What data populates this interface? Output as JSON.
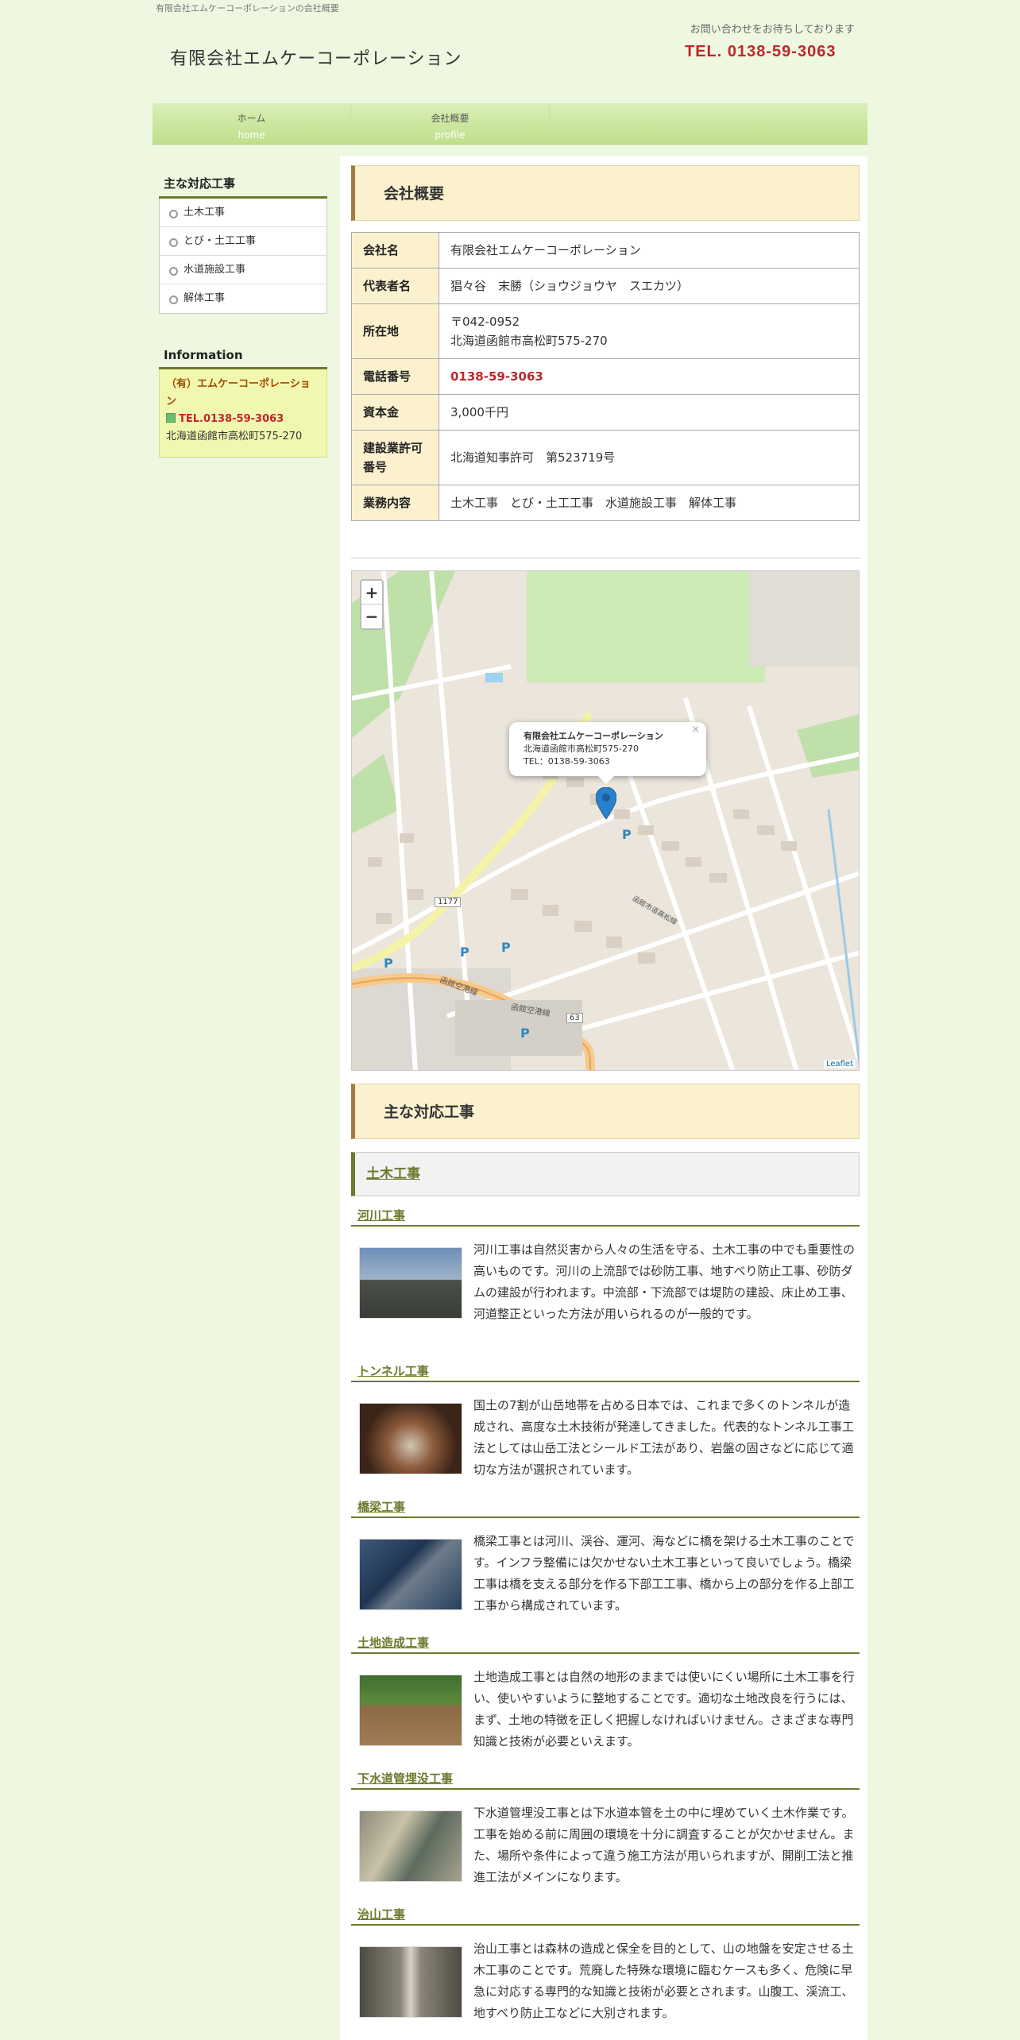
{
  "header": {
    "tagline": "有限会社エムケーコーポレーションの会社概要",
    "site_title": "有限会社エムケーコーポレーション",
    "contact_note": "お問い合わせをお待ちしております",
    "contact_tel": "TEL. 0138-59-3063"
  },
  "nav": [
    {
      "jp": "ホーム",
      "en": "home"
    },
    {
      "jp": "会社概要",
      "en": "profile"
    }
  ],
  "sidebar": {
    "works_title": "主な対応工事",
    "works": [
      "土木工事",
      "とび・土工工事",
      "水道施設工事",
      "解体工事"
    ],
    "info_title": "Information",
    "info_name": "（有）エムケーコーポレーション",
    "info_tel": "TEL.0138-59-3063",
    "info_address": "北海道函館市高松町575-270"
  },
  "profile": {
    "title": "会社概要",
    "rows": [
      {
        "label": "会社名",
        "value": "有限会社エムケーコーポレーション"
      },
      {
        "label": "代表者名",
        "value": "猖々谷　末勝（ショウジョウヤ　スエカツ）"
      },
      {
        "label": "所在地",
        "value": "〒042-0952",
        "value2": "北海道函館市高松町575-270"
      },
      {
        "label": "電話番号",
        "value": "0138-59-3063"
      },
      {
        "label": "資本金",
        "value": "3,000千円"
      },
      {
        "label": "建設業許可番号",
        "value": "北海道知事許可　第523719号"
      },
      {
        "label": "業務内容",
        "value": "土木工事　とび・土工工事　水道施設工事　解体工事"
      }
    ]
  },
  "map": {
    "zoom_in": "+",
    "zoom_out": "−",
    "popup_name": "有限会社エムケーコーポレーション",
    "popup_address": "北海道函館市高松町575-270",
    "popup_tel": "TEL：0138-59-3063",
    "popup_close": "×",
    "attribution": "Leaflet",
    "route_label": "1177",
    "route_label2": "63",
    "road_label1": "函館空港線",
    "road_label2": "函館空港線",
    "road_label3": "函館市道高松線",
    "parking": "P"
  },
  "works": {
    "title": "主な対応工事",
    "category": "土木工事",
    "items": [
      {
        "title": "河川工事",
        "text": "河川工事は自然災害から人々の生活を守る、土木工事の中でも重要性の高いものです。河川の上流部では砂防工事、地すべり防止工事、砂防ダムの建設が行われます。中流部・下流部では堤防の建設、床止め工事、河道整正といった方法が用いられるのが一般的です。"
      },
      {
        "title": "トンネル工事",
        "text": "国土の7割が山岳地帯を占める日本では、これまで多くのトンネルが造成され、高度な土木技術が発達してきました。代表的なトンネル工事工法としては山岳工法とシールド工法があり、岩盤の固さなどに応じて適切な方法が選択されています。"
      },
      {
        "title": "橋梁工事",
        "text": "橋梁工事とは河川、渓谷、運河、海などに橋を架ける土木工事のことです。インフラ整備には欠かせない土木工事といって良いでしょう。橋梁工事は橋を支える部分を作る下部工工事、橋から上の部分を作る上部工工事から構成されています。"
      },
      {
        "title": "土地造成工事",
        "text": "土地造成工事とは自然の地形のままでは使いにくい場所に土木工事を行い、使いやすいように整地することです。適切な土地改良を行うには、まず、土地の特徴を正しく把握しなければいけません。さまざまな専門知識と技術が必要といえます。"
      },
      {
        "title": "下水道管埋没工事",
        "text": "下水道管埋没工事とは下水道本管を土の中に埋めていく土木作業です。工事を始める前に周囲の環境を十分に調査することが欠かせません。また、場所や条件によって違う施工方法が用いられますが、開削工法と推進工法がメインになります。"
      },
      {
        "title": "治山工事",
        "text": "治山工事とは森林の造成と保全を目的として、山の地盤を安定させる土木工事のことです。荒廃した特殊な環境に臨むケースも多く、危険に早急に対応する専門的な知識と技術が必要とされます。山腹工、渓流工、地すべり防止工などに大別されます。"
      }
    ]
  }
}
